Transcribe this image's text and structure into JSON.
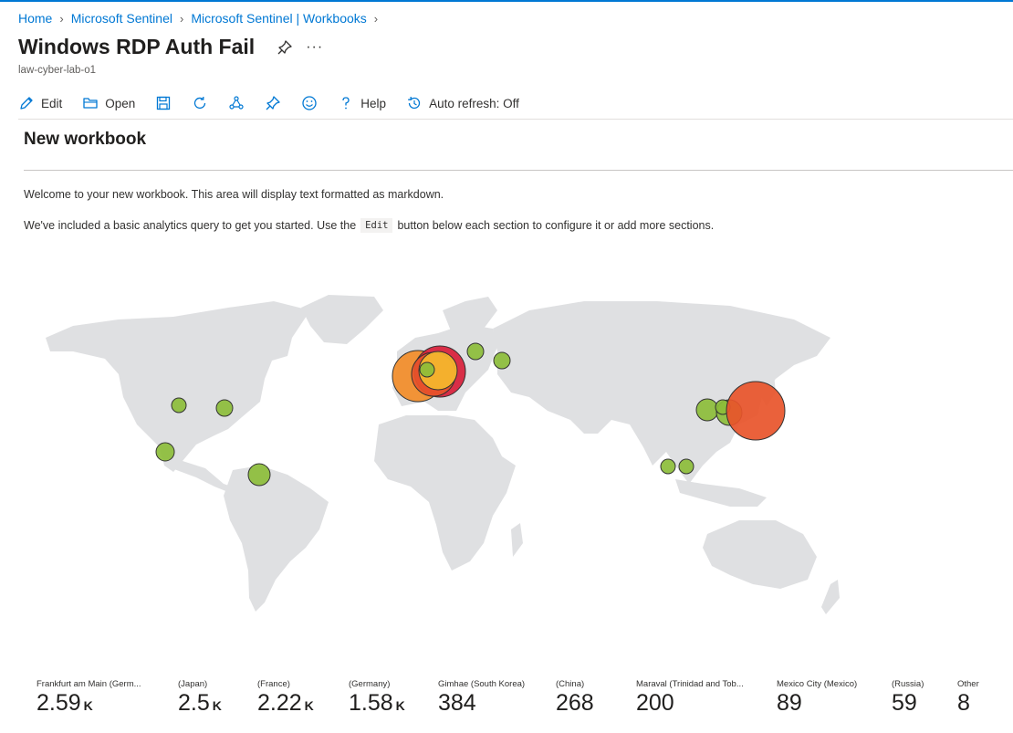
{
  "breadcrumb": [
    "Home",
    "Microsoft Sentinel",
    "Microsoft Sentinel | Workbooks"
  ],
  "page": {
    "title": "Windows RDP Auth Fail",
    "subtitle": "law-cyber-lab-o1"
  },
  "toolbar": {
    "edit": "Edit",
    "open": "Open",
    "help": "Help",
    "auto_refresh": "Auto refresh: Off"
  },
  "section": {
    "title": "New workbook",
    "md_line1": "Welcome to your new workbook. This area will display text formatted as markdown.",
    "md_line2_before": "We've included a basic analytics query to get you started. Use the",
    "md_line2_code": "Edit",
    "md_line2_after": "button below each section to configure it or add more sections."
  },
  "colors": {
    "accent": "#0078d4",
    "land": "#dfe0e2",
    "bubble_high": "#e8542a",
    "bubble_mid": "#f28c28",
    "bubble_yellow": "#f5b82e",
    "bubble_red": "#d81e3a",
    "bubble_low": "#8cbd3a"
  },
  "tiles": [
    {
      "location": "Frankfurt am Main (Germ...",
      "value": "2.59",
      "unit": "K"
    },
    {
      "location": "(Japan)",
      "value": "2.5",
      "unit": "K"
    },
    {
      "location": "(France)",
      "value": "2.22",
      "unit": "K"
    },
    {
      "location": "(Germany)",
      "value": "1.58",
      "unit": "K"
    },
    {
      "location": "Gimhae (South Korea)",
      "value": "384",
      "unit": ""
    },
    {
      "location": "(China)",
      "value": "268",
      "unit": ""
    },
    {
      "location": "Maraval (Trinidad and Tob...",
      "value": "200",
      "unit": ""
    },
    {
      "location": "Mexico City (Mexico)",
      "value": "89",
      "unit": ""
    },
    {
      "location": "(Russia)",
      "value": "59",
      "unit": ""
    },
    {
      "location": "Other",
      "value": "8",
      "unit": ""
    }
  ]
}
